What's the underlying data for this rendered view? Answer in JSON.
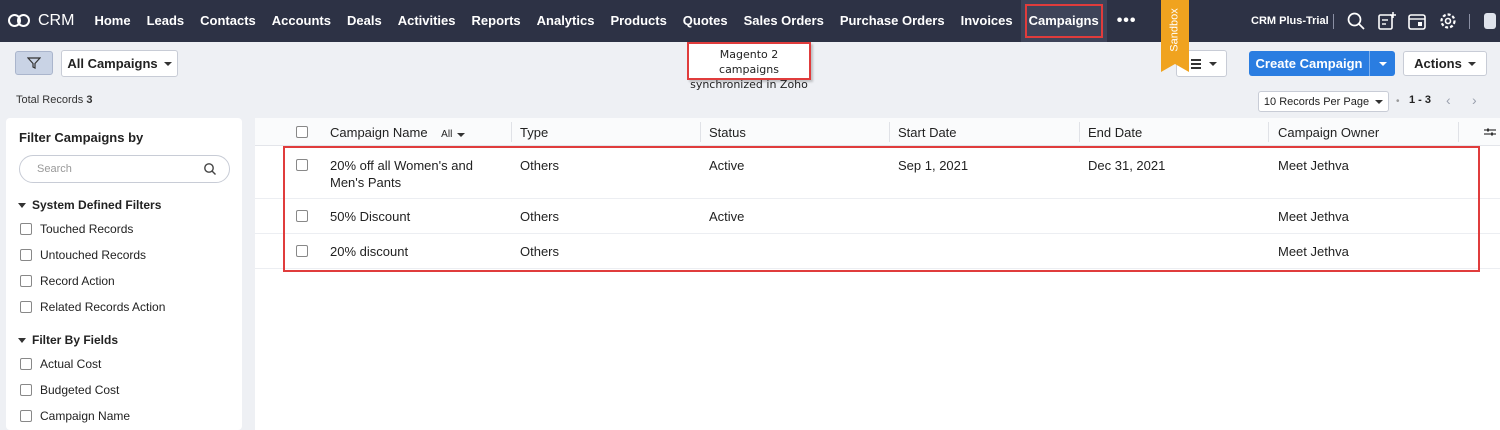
{
  "app": {
    "logo_text": "CRM"
  },
  "nav": {
    "items": [
      "Home",
      "Leads",
      "Contacts",
      "Accounts",
      "Deals",
      "Activities",
      "Reports",
      "Analytics",
      "Products",
      "Quotes",
      "Sales Orders",
      "Purchase Orders",
      "Invoices",
      "Campaigns"
    ],
    "active": "Campaigns",
    "more": "•••",
    "sandbox_label": "Sandbox",
    "edition": "CRM Plus-Trial"
  },
  "toolbar": {
    "view_label": "All Campaigns",
    "create_label": "Create Campaign",
    "actions_label": "Actions"
  },
  "callout": {
    "line1": "Magento 2 campaigns",
    "line2": "synchronized in Zoho"
  },
  "records": {
    "total_label": "Total Records",
    "total_count": "3",
    "per_page": "10 Records Per Page",
    "range": "1 - 3",
    "dot": "•"
  },
  "sidebar": {
    "title": "Filter Campaigns by",
    "search_placeholder": "Search",
    "system_section": "System Defined Filters",
    "system_items": [
      "Touched Records",
      "Untouched Records",
      "Record Action",
      "Related Records Action"
    ],
    "fields_section": "Filter By Fields",
    "field_items": [
      "Actual Cost",
      "Budgeted Cost",
      "Campaign Name"
    ]
  },
  "table": {
    "columns": [
      "Campaign Name",
      "Type",
      "Status",
      "Start Date",
      "End Date",
      "Campaign Owner"
    ],
    "name_filter": "All",
    "rows": [
      {
        "name": "20% off all Women's and Men's Pants",
        "type": "Others",
        "status": "Active",
        "start": "Sep 1, 2021",
        "end": "Dec 31, 2021",
        "owner": "Meet Jethva"
      },
      {
        "name": "50% Discount",
        "type": "Others",
        "status": "Active",
        "start": "",
        "end": "",
        "owner": "Meet Jethva"
      },
      {
        "name": "20% discount",
        "type": "Others",
        "status": "",
        "start": "",
        "end": "",
        "owner": "Meet Jethva"
      }
    ]
  },
  "colors": {
    "nav_bg": "#2d3245",
    "accent": "#2a7de1",
    "highlight": "#e03c3c",
    "sandbox": "#f0a31f"
  }
}
